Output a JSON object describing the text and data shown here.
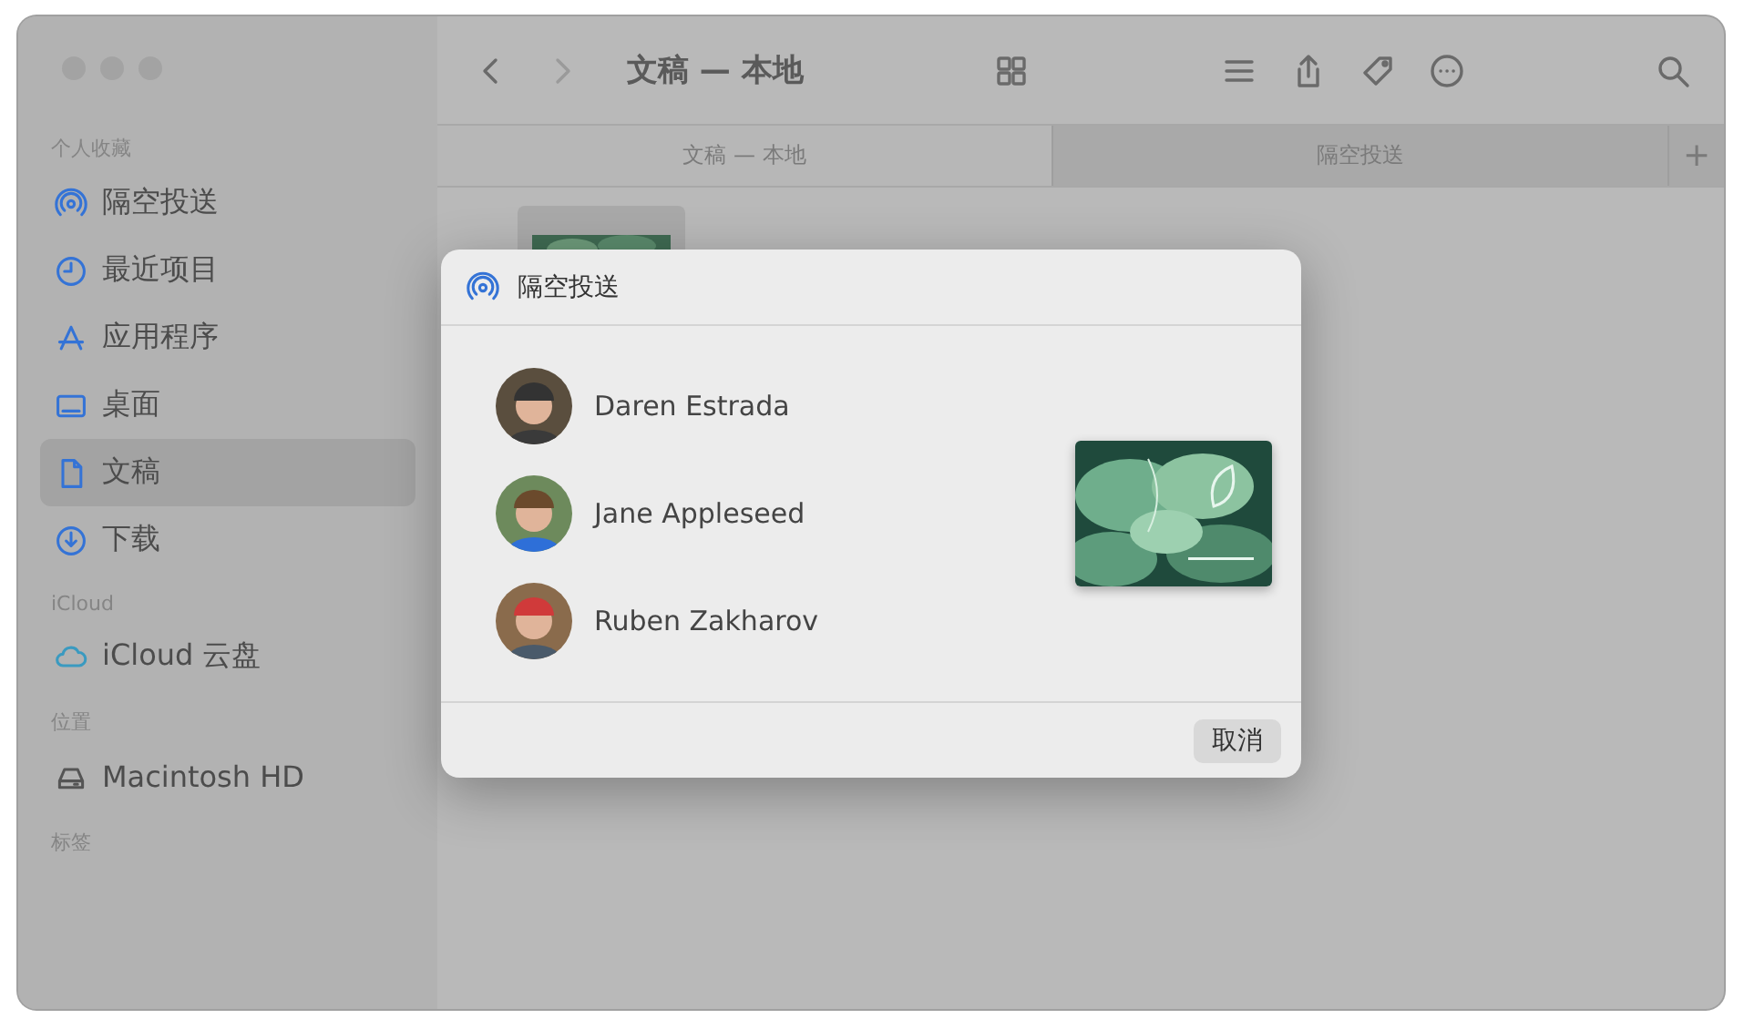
{
  "window": {
    "title": "文稿 — 本地"
  },
  "sidebar": {
    "sections": [
      {
        "title": "个人收藏",
        "items": [
          {
            "label": "隔空投送",
            "selected": false
          },
          {
            "label": "最近项目",
            "selected": false
          },
          {
            "label": "应用程序",
            "selected": false
          },
          {
            "label": "桌面",
            "selected": false
          },
          {
            "label": "文稿",
            "selected": true
          },
          {
            "label": "下载",
            "selected": false
          }
        ]
      },
      {
        "title": "iCloud",
        "items": [
          {
            "label": "iCloud 云盘",
            "selected": false
          }
        ]
      },
      {
        "title": "位置",
        "items": [
          {
            "label": "Macintosh HD",
            "selected": false
          }
        ]
      },
      {
        "title": "标签"
      }
    ]
  },
  "tabs": [
    {
      "label": "文稿 — 本地",
      "selected": true
    },
    {
      "label": "隔空投送",
      "selected": false
    }
  ],
  "tab_add": "+",
  "dialog": {
    "title": "隔空投送",
    "recipients": [
      {
        "name": "Daren Estrada"
      },
      {
        "name": "Jane Appleseed"
      },
      {
        "name": "Ruben Zakharov"
      }
    ],
    "cancel": "取消"
  }
}
